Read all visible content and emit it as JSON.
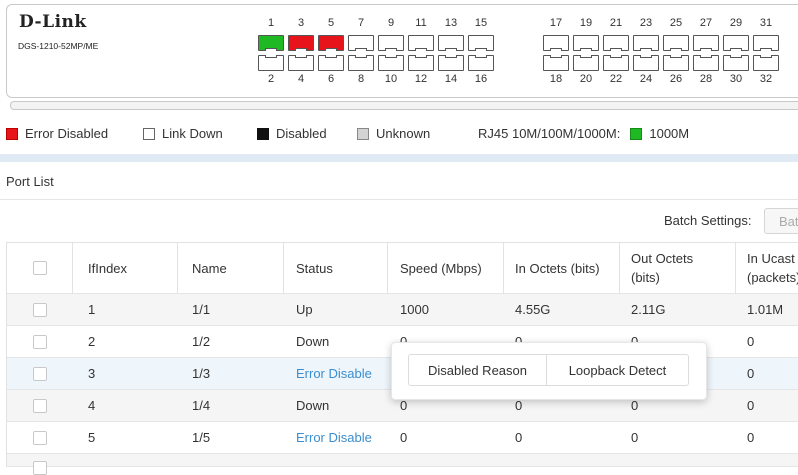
{
  "device": {
    "brand": "D-Link",
    "model": "DGS-1210-52MP/ME",
    "top_port_numbers": [
      "1",
      "3",
      "5",
      "7",
      "9",
      "11",
      "13",
      "15",
      "17",
      "19",
      "21",
      "23",
      "25",
      "27",
      "29",
      "31"
    ],
    "bottom_port_numbers": [
      "2",
      "4",
      "6",
      "8",
      "10",
      "12",
      "14",
      "16",
      "18",
      "20",
      "22",
      "24",
      "26",
      "28",
      "30",
      "32"
    ],
    "top_port_states": [
      "1000M",
      "error-disabled",
      "error-disabled",
      "link-down",
      "link-down",
      "link-down",
      "link-down",
      "link-down",
      "link-down",
      "link-down",
      "link-down",
      "link-down",
      "link-down",
      "link-down",
      "link-down",
      "link-down"
    ],
    "bottom_port_states": [
      "link-down",
      "link-down",
      "link-down",
      "link-down",
      "link-down",
      "link-down",
      "link-down",
      "link-down",
      "link-down",
      "link-down",
      "link-down",
      "link-down",
      "link-down",
      "link-down",
      "link-down",
      "link-down"
    ]
  },
  "legend": {
    "error_disabled": "Error Disabled",
    "link_down": "Link Down",
    "disabled": "Disabled",
    "unknown": "Unknown",
    "rj45": "RJ45 10M/100M/1000M:",
    "speed_1000m": "1000M",
    "colors": {
      "error_disabled": "#e8141c",
      "link_down": "#ffffff",
      "disabled": "#111111",
      "unknown": "#d3d3d3",
      "speed_1000m": "#1eb923"
    }
  },
  "port_list": {
    "title": "Port List",
    "batch_settings_label": "Batch Settings:",
    "batch_button": "Batch",
    "columns": [
      "IfIndex",
      "Name",
      "Status",
      "Speed (Mbps)",
      "In Octets (bits)",
      "Out Octets (bits)",
      "In Ucast (packets)"
    ],
    "rows": [
      {
        "ifindex": "1",
        "name": "1/1",
        "status": "Up",
        "speed": "1000",
        "in_octets": "4.55G",
        "out_octets": "2.11G",
        "in_ucast": "1.01M"
      },
      {
        "ifindex": "2",
        "name": "1/2",
        "status": "Down",
        "speed": "0",
        "in_octets": "0",
        "out_octets": "0",
        "in_ucast": "0"
      },
      {
        "ifindex": "3",
        "name": "1/3",
        "status": "Error Disable",
        "speed": "",
        "in_octets": "",
        "out_octets": "",
        "in_ucast": "0"
      },
      {
        "ifindex": "4",
        "name": "1/4",
        "status": "Down",
        "speed": "0",
        "in_octets": "0",
        "out_octets": "0",
        "in_ucast": "0"
      },
      {
        "ifindex": "5",
        "name": "1/5",
        "status": "Error Disable",
        "speed": "0",
        "in_octets": "0",
        "out_octets": "0",
        "in_ucast": "0"
      }
    ],
    "link_color": "#3a8ed0"
  },
  "popup": {
    "disabled_reason": "Disabled Reason",
    "loopback_detect": "Loopback Detect"
  }
}
